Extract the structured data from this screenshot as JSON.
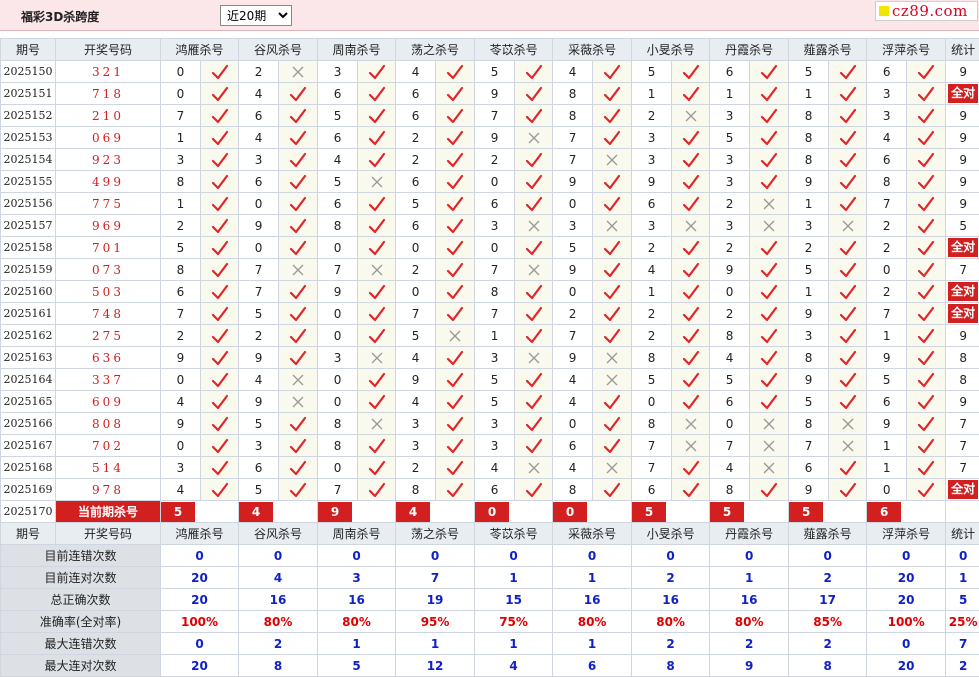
{
  "page": {
    "title": "福彩3D杀跨度",
    "select_value": "近20期",
    "select_options": [
      "近20期"
    ],
    "logo_text": "cz89.com"
  },
  "colors": {
    "mark_red": "#e0262a",
    "cross_gray": "#999999",
    "accent_red": "#d21f1f",
    "value_blue": "#1020c8"
  },
  "headers": [
    "期号",
    "开奖号码",
    "鸿雁杀号",
    "谷风杀号",
    "周南杀号",
    "荡之杀号",
    "苓苡杀号",
    "采薇杀号",
    "小旻杀号",
    "丹霞杀号",
    "薤露杀号",
    "浮萍杀号",
    "统计"
  ],
  "rows": [
    {
      "period": "2025150",
      "draw": "321",
      "kills": [
        {
          "n": "0",
          "ok": true
        },
        {
          "n": "2",
          "ok": false
        },
        {
          "n": "3",
          "ok": true
        },
        {
          "n": "4",
          "ok": true
        },
        {
          "n": "5",
          "ok": true
        },
        {
          "n": "4",
          "ok": true
        },
        {
          "n": "5",
          "ok": true
        },
        {
          "n": "6",
          "ok": true
        },
        {
          "n": "5",
          "ok": true
        },
        {
          "n": "6",
          "ok": true
        }
      ],
      "stat": "9"
    },
    {
      "period": "2025151",
      "draw": "718",
      "kills": [
        {
          "n": "0",
          "ok": true
        },
        {
          "n": "4",
          "ok": true
        },
        {
          "n": "6",
          "ok": true
        },
        {
          "n": "6",
          "ok": true
        },
        {
          "n": "9",
          "ok": true
        },
        {
          "n": "8",
          "ok": true
        },
        {
          "n": "1",
          "ok": true
        },
        {
          "n": "1",
          "ok": true
        },
        {
          "n": "1",
          "ok": true
        },
        {
          "n": "3",
          "ok": true
        }
      ],
      "stat": "全对"
    },
    {
      "period": "2025152",
      "draw": "210",
      "kills": [
        {
          "n": "7",
          "ok": true
        },
        {
          "n": "6",
          "ok": true
        },
        {
          "n": "5",
          "ok": true
        },
        {
          "n": "6",
          "ok": true
        },
        {
          "n": "7",
          "ok": true
        },
        {
          "n": "8",
          "ok": true
        },
        {
          "n": "2",
          "ok": false
        },
        {
          "n": "3",
          "ok": true
        },
        {
          "n": "8",
          "ok": true
        },
        {
          "n": "3",
          "ok": true
        }
      ],
      "stat": "9"
    },
    {
      "period": "2025153",
      "draw": "069",
      "kills": [
        {
          "n": "1",
          "ok": true
        },
        {
          "n": "4",
          "ok": true
        },
        {
          "n": "6",
          "ok": true
        },
        {
          "n": "2",
          "ok": true
        },
        {
          "n": "9",
          "ok": false
        },
        {
          "n": "7",
          "ok": true
        },
        {
          "n": "3",
          "ok": true
        },
        {
          "n": "5",
          "ok": true
        },
        {
          "n": "8",
          "ok": true
        },
        {
          "n": "4",
          "ok": true
        }
      ],
      "stat": "9"
    },
    {
      "period": "2025154",
      "draw": "923",
      "kills": [
        {
          "n": "3",
          "ok": true
        },
        {
          "n": "3",
          "ok": true
        },
        {
          "n": "4",
          "ok": true
        },
        {
          "n": "2",
          "ok": true
        },
        {
          "n": "2",
          "ok": true
        },
        {
          "n": "7",
          "ok": false
        },
        {
          "n": "3",
          "ok": true
        },
        {
          "n": "3",
          "ok": true
        },
        {
          "n": "8",
          "ok": true
        },
        {
          "n": "6",
          "ok": true
        }
      ],
      "stat": "9"
    },
    {
      "period": "2025155",
      "draw": "499",
      "kills": [
        {
          "n": "8",
          "ok": true
        },
        {
          "n": "6",
          "ok": true
        },
        {
          "n": "5",
          "ok": false
        },
        {
          "n": "6",
          "ok": true
        },
        {
          "n": "0",
          "ok": true
        },
        {
          "n": "9",
          "ok": true
        },
        {
          "n": "9",
          "ok": true
        },
        {
          "n": "3",
          "ok": true
        },
        {
          "n": "9",
          "ok": true
        },
        {
          "n": "8",
          "ok": true
        }
      ],
      "stat": "9"
    },
    {
      "period": "2025156",
      "draw": "775",
      "kills": [
        {
          "n": "1",
          "ok": true
        },
        {
          "n": "0",
          "ok": true
        },
        {
          "n": "6",
          "ok": true
        },
        {
          "n": "5",
          "ok": true
        },
        {
          "n": "6",
          "ok": true
        },
        {
          "n": "0",
          "ok": true
        },
        {
          "n": "6",
          "ok": true
        },
        {
          "n": "2",
          "ok": false
        },
        {
          "n": "1",
          "ok": true
        },
        {
          "n": "7",
          "ok": true
        }
      ],
      "stat": "9"
    },
    {
      "period": "2025157",
      "draw": "969",
      "kills": [
        {
          "n": "2",
          "ok": true
        },
        {
          "n": "9",
          "ok": true
        },
        {
          "n": "8",
          "ok": true
        },
        {
          "n": "6",
          "ok": true
        },
        {
          "n": "3",
          "ok": false
        },
        {
          "n": "3",
          "ok": false
        },
        {
          "n": "3",
          "ok": false
        },
        {
          "n": "3",
          "ok": false
        },
        {
          "n": "3",
          "ok": false
        },
        {
          "n": "2",
          "ok": true
        }
      ],
      "stat": "5"
    },
    {
      "period": "2025158",
      "draw": "701",
      "kills": [
        {
          "n": "5",
          "ok": true
        },
        {
          "n": "0",
          "ok": true
        },
        {
          "n": "0",
          "ok": true
        },
        {
          "n": "0",
          "ok": true
        },
        {
          "n": "0",
          "ok": true
        },
        {
          "n": "5",
          "ok": true
        },
        {
          "n": "2",
          "ok": true
        },
        {
          "n": "2",
          "ok": true
        },
        {
          "n": "2",
          "ok": true
        },
        {
          "n": "2",
          "ok": true
        }
      ],
      "stat": "全对"
    },
    {
      "period": "2025159",
      "draw": "073",
      "kills": [
        {
          "n": "8",
          "ok": true
        },
        {
          "n": "7",
          "ok": false
        },
        {
          "n": "7",
          "ok": false
        },
        {
          "n": "2",
          "ok": true
        },
        {
          "n": "7",
          "ok": false
        },
        {
          "n": "9",
          "ok": true
        },
        {
          "n": "4",
          "ok": true
        },
        {
          "n": "9",
          "ok": true
        },
        {
          "n": "5",
          "ok": true
        },
        {
          "n": "0",
          "ok": true
        }
      ],
      "stat": "7"
    },
    {
      "period": "2025160",
      "draw": "503",
      "kills": [
        {
          "n": "6",
          "ok": true
        },
        {
          "n": "7",
          "ok": true
        },
        {
          "n": "9",
          "ok": true
        },
        {
          "n": "0",
          "ok": true
        },
        {
          "n": "8",
          "ok": true
        },
        {
          "n": "0",
          "ok": true
        },
        {
          "n": "1",
          "ok": true
        },
        {
          "n": "0",
          "ok": true
        },
        {
          "n": "1",
          "ok": true
        },
        {
          "n": "2",
          "ok": true
        }
      ],
      "stat": "全对"
    },
    {
      "period": "2025161",
      "draw": "748",
      "kills": [
        {
          "n": "7",
          "ok": true
        },
        {
          "n": "5",
          "ok": true
        },
        {
          "n": "0",
          "ok": true
        },
        {
          "n": "7",
          "ok": true
        },
        {
          "n": "7",
          "ok": true
        },
        {
          "n": "2",
          "ok": true
        },
        {
          "n": "2",
          "ok": true
        },
        {
          "n": "2",
          "ok": true
        },
        {
          "n": "9",
          "ok": true
        },
        {
          "n": "7",
          "ok": true
        }
      ],
      "stat": "全对"
    },
    {
      "period": "2025162",
      "draw": "275",
      "kills": [
        {
          "n": "2",
          "ok": true
        },
        {
          "n": "2",
          "ok": true
        },
        {
          "n": "0",
          "ok": true
        },
        {
          "n": "5",
          "ok": false
        },
        {
          "n": "1",
          "ok": true
        },
        {
          "n": "7",
          "ok": true
        },
        {
          "n": "2",
          "ok": true
        },
        {
          "n": "8",
          "ok": true
        },
        {
          "n": "3",
          "ok": true
        },
        {
          "n": "1",
          "ok": true
        }
      ],
      "stat": "9"
    },
    {
      "period": "2025163",
      "draw": "636",
      "kills": [
        {
          "n": "9",
          "ok": true
        },
        {
          "n": "9",
          "ok": true
        },
        {
          "n": "3",
          "ok": false
        },
        {
          "n": "4",
          "ok": true
        },
        {
          "n": "3",
          "ok": false
        },
        {
          "n": "9",
          "ok": false
        },
        {
          "n": "8",
          "ok": true
        },
        {
          "n": "4",
          "ok": true
        },
        {
          "n": "8",
          "ok": true
        },
        {
          "n": "9",
          "ok": true
        }
      ],
      "stat": "8"
    },
    {
      "period": "2025164",
      "draw": "337",
      "kills": [
        {
          "n": "0",
          "ok": true
        },
        {
          "n": "4",
          "ok": false
        },
        {
          "n": "0",
          "ok": true
        },
        {
          "n": "9",
          "ok": true
        },
        {
          "n": "5",
          "ok": true
        },
        {
          "n": "4",
          "ok": false
        },
        {
          "n": "5",
          "ok": true
        },
        {
          "n": "5",
          "ok": true
        },
        {
          "n": "9",
          "ok": true
        },
        {
          "n": "5",
          "ok": true
        }
      ],
      "stat": "8"
    },
    {
      "period": "2025165",
      "draw": "609",
      "kills": [
        {
          "n": "4",
          "ok": true
        },
        {
          "n": "9",
          "ok": false
        },
        {
          "n": "0",
          "ok": true
        },
        {
          "n": "4",
          "ok": true
        },
        {
          "n": "5",
          "ok": true
        },
        {
          "n": "4",
          "ok": true
        },
        {
          "n": "0",
          "ok": true
        },
        {
          "n": "6",
          "ok": true
        },
        {
          "n": "5",
          "ok": true
        },
        {
          "n": "6",
          "ok": true
        }
      ],
      "stat": "9"
    },
    {
      "period": "2025166",
      "draw": "808",
      "kills": [
        {
          "n": "9",
          "ok": true
        },
        {
          "n": "5",
          "ok": true
        },
        {
          "n": "8",
          "ok": false
        },
        {
          "n": "3",
          "ok": true
        },
        {
          "n": "3",
          "ok": true
        },
        {
          "n": "0",
          "ok": true
        },
        {
          "n": "8",
          "ok": false
        },
        {
          "n": "0",
          "ok": false
        },
        {
          "n": "8",
          "ok": false
        },
        {
          "n": "9",
          "ok": true
        }
      ],
      "stat": "7"
    },
    {
      "period": "2025167",
      "draw": "702",
      "kills": [
        {
          "n": "0",
          "ok": true
        },
        {
          "n": "3",
          "ok": true
        },
        {
          "n": "8",
          "ok": true
        },
        {
          "n": "3",
          "ok": true
        },
        {
          "n": "3",
          "ok": true
        },
        {
          "n": "6",
          "ok": true
        },
        {
          "n": "7",
          "ok": false
        },
        {
          "n": "7",
          "ok": false
        },
        {
          "n": "7",
          "ok": false
        },
        {
          "n": "1",
          "ok": true
        }
      ],
      "stat": "7"
    },
    {
      "period": "2025168",
      "draw": "514",
      "kills": [
        {
          "n": "3",
          "ok": true
        },
        {
          "n": "6",
          "ok": true
        },
        {
          "n": "0",
          "ok": true
        },
        {
          "n": "2",
          "ok": true
        },
        {
          "n": "4",
          "ok": false
        },
        {
          "n": "4",
          "ok": false
        },
        {
          "n": "7",
          "ok": true
        },
        {
          "n": "4",
          "ok": false
        },
        {
          "n": "6",
          "ok": true
        },
        {
          "n": "1",
          "ok": true
        }
      ],
      "stat": "7"
    },
    {
      "period": "2025169",
      "draw": "978",
      "kills": [
        {
          "n": "4",
          "ok": true
        },
        {
          "n": "5",
          "ok": true
        },
        {
          "n": "7",
          "ok": true
        },
        {
          "n": "8",
          "ok": true
        },
        {
          "n": "6",
          "ok": true
        },
        {
          "n": "8",
          "ok": true
        },
        {
          "n": "6",
          "ok": true
        },
        {
          "n": "8",
          "ok": true
        },
        {
          "n": "9",
          "ok": true
        },
        {
          "n": "0",
          "ok": true
        }
      ],
      "stat": "全对"
    }
  ],
  "current": {
    "period": "2025170",
    "label": "当前期杀号",
    "values": [
      "5",
      "4",
      "9",
      "4",
      "0",
      "0",
      "5",
      "5",
      "5",
      "6"
    ]
  },
  "summary": [
    {
      "label": "目前连错次数",
      "values": [
        "0",
        "0",
        "0",
        "0",
        "0",
        "0",
        "0",
        "0",
        "0",
        "0",
        "0"
      ],
      "red": false
    },
    {
      "label": "目前连对次数",
      "values": [
        "20",
        "4",
        "3",
        "7",
        "1",
        "1",
        "2",
        "1",
        "2",
        "20",
        "1"
      ],
      "red": false
    },
    {
      "label": "总正确次数",
      "values": [
        "20",
        "16",
        "16",
        "19",
        "15",
        "16",
        "16",
        "16",
        "17",
        "20",
        "5"
      ],
      "red": false
    },
    {
      "label": "准确率(全对率)",
      "values": [
        "100%",
        "80%",
        "80%",
        "95%",
        "75%",
        "80%",
        "80%",
        "80%",
        "85%",
        "100%",
        "25%"
      ],
      "red": true
    },
    {
      "label": "最大连错次数",
      "values": [
        "0",
        "2",
        "1",
        "1",
        "1",
        "1",
        "2",
        "2",
        "2",
        "0",
        "7"
      ],
      "red": false
    },
    {
      "label": "最大连对次数",
      "values": [
        "20",
        "8",
        "5",
        "12",
        "4",
        "6",
        "8",
        "9",
        "8",
        "20",
        "2"
      ],
      "red": false
    }
  ]
}
